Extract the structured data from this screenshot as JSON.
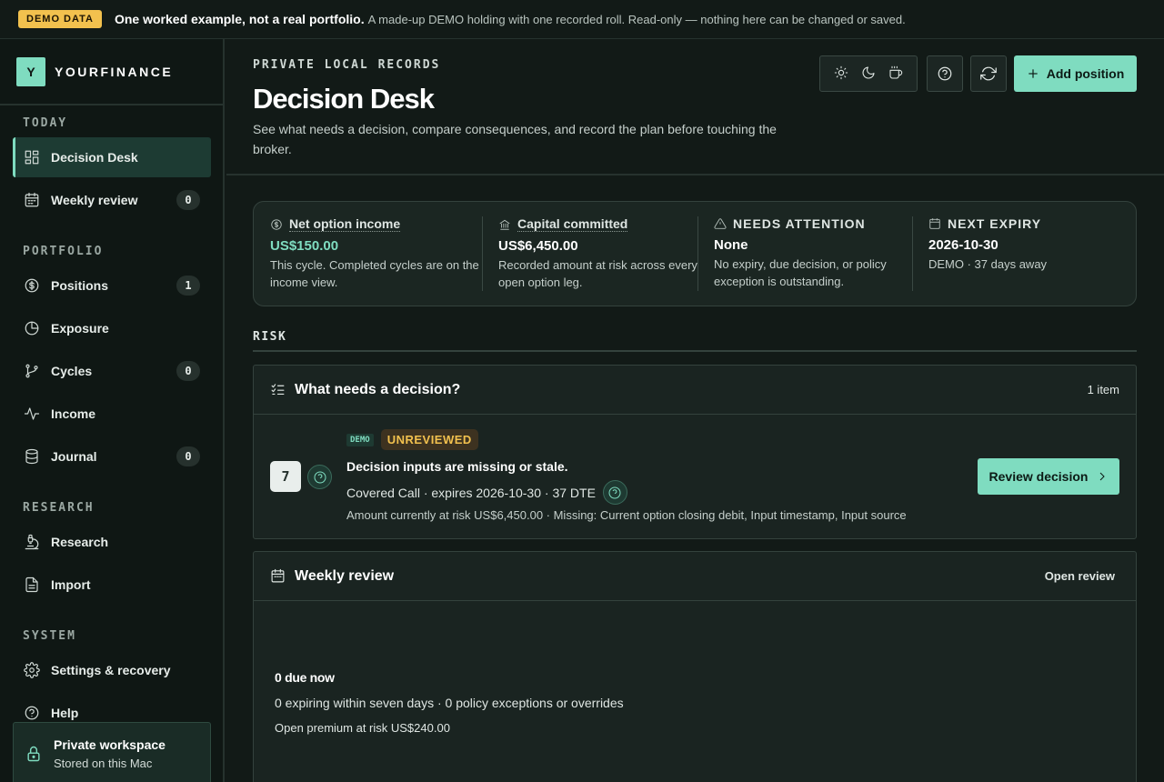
{
  "banner": {
    "badge": "DEMO DATA",
    "headline": "One worked example, not a real portfolio.",
    "text": "A made-up DEMO holding with one recorded roll. Read-only — nothing here can be changed or saved."
  },
  "brand": {
    "logo": "Y",
    "name": "YOURFINANCE"
  },
  "sidebar": {
    "sections": [
      {
        "title": "TODAY",
        "items": [
          {
            "label": "Decision Desk",
            "icon": "dashboard-icon",
            "active": true
          },
          {
            "label": "Weekly review",
            "icon": "calendar-icon",
            "count": "0"
          }
        ]
      },
      {
        "title": "PORTFOLIO",
        "items": [
          {
            "label": "Positions",
            "icon": "dollar-circle-icon",
            "count": "1"
          },
          {
            "label": "Exposure",
            "icon": "pie-chart-icon"
          },
          {
            "label": "Cycles",
            "icon": "git-branch-icon",
            "count": "0"
          },
          {
            "label": "Income",
            "icon": "activity-icon"
          },
          {
            "label": "Journal",
            "icon": "database-icon",
            "count": "0"
          }
        ]
      },
      {
        "title": "RESEARCH",
        "items": [
          {
            "label": "Research",
            "icon": "microscope-icon"
          },
          {
            "label": "Import",
            "icon": "file-icon"
          }
        ]
      },
      {
        "title": "SYSTEM",
        "items": [
          {
            "label": "Settings & recovery",
            "icon": "gear-icon"
          },
          {
            "label": "Help",
            "icon": "help-circle-icon"
          }
        ]
      }
    ],
    "workspace": {
      "title": "Private workspace",
      "subtitle": "Stored on this Mac"
    }
  },
  "header": {
    "eyebrow": "PRIVATE LOCAL RECORDS",
    "title": "Decision Desk",
    "subtitle": "See what needs a decision, compare consequences, and record the plan before touching the broker.",
    "add_label": "Add position"
  },
  "stats": [
    {
      "label": "Net option income",
      "icon": "dollar-circle-icon",
      "value": "US$150.00",
      "desc": "This cycle. Completed cycles are on the income view."
    },
    {
      "label": "Capital committed",
      "icon": "bank-icon",
      "value": "US$6,450.00",
      "desc": "Recorded amount at risk across every open option leg."
    },
    {
      "label": "Needs attention",
      "icon": "alert-triangle-icon",
      "value": "None",
      "desc": "No expiry, due decision, or policy exception is outstanding."
    },
    {
      "label": "Next expiry",
      "icon": "calendar-icon",
      "value": "2026-10-30",
      "desc": "DEMO · 37 days away"
    }
  ],
  "risk_label": "RISK",
  "decision_panel": {
    "title": "What needs a decision?",
    "meta": "1 item",
    "item": {
      "dte": "7",
      "tag_demo": "DEMO",
      "tag_status": "UNREVIEWED",
      "title": "Decision inputs are missing or stale.",
      "line": "Covered Call · expires 2026-10-30 · 37 DTE",
      "detail": "Amount currently at risk US$6,450.00 · Missing: Current option closing debit, Input timestamp, Input source",
      "button": "Review decision"
    }
  },
  "weekly_panel": {
    "title": "Weekly review",
    "link": "Open review",
    "due": "0 due now",
    "line": "0 expiring within seven days · 0 policy exceptions or overrides",
    "premium": "Open premium at risk US$240.00"
  },
  "colors": {
    "accent": "#7fdcc0",
    "warning": "#f2c14e",
    "background": "#121a17"
  }
}
